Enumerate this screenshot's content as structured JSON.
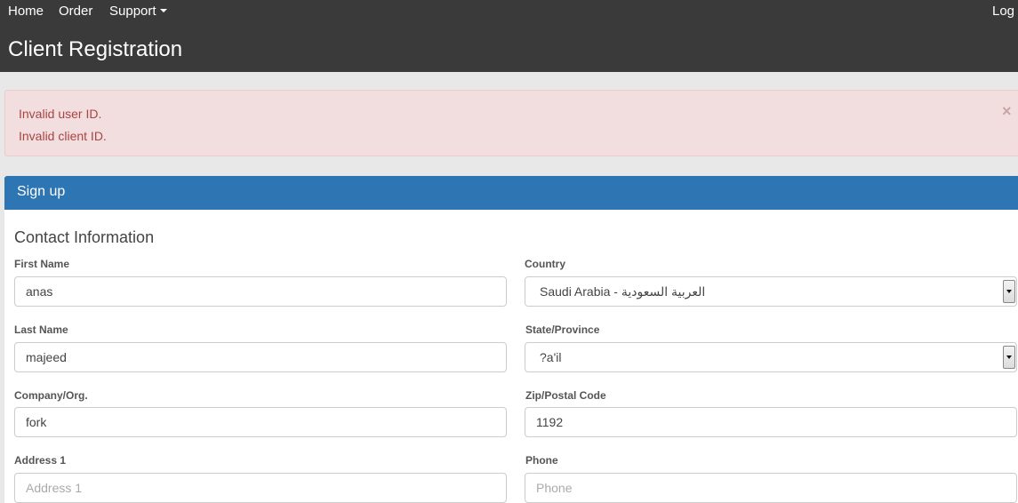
{
  "nav": {
    "home": "Home",
    "order": "Order",
    "support": "Support",
    "login": "Log"
  },
  "header": {
    "title": "Client Registration"
  },
  "alert": {
    "messages": [
      "Invalid user ID.",
      "Invalid client ID."
    ],
    "close": "×"
  },
  "panel": {
    "heading": "Sign up"
  },
  "form": {
    "section_title": "Contact Information",
    "first_name": {
      "label": "First Name",
      "value": "anas"
    },
    "last_name": {
      "label": "Last Name",
      "value": "majeed"
    },
    "company": {
      "label": "Company/Org.",
      "value": "fork"
    },
    "address1": {
      "label": "Address 1",
      "placeholder": "Address 1"
    },
    "country": {
      "label": "Country",
      "value": "Saudi Arabia - العربية السعودية"
    },
    "state": {
      "label": "State/Province",
      "value": "?a'il"
    },
    "zip": {
      "label": "Zip/Postal Code",
      "value": "1192"
    },
    "phone": {
      "label": "Phone",
      "placeholder": "Phone"
    }
  },
  "colors": {
    "topbar": "#3a3a3a",
    "alert_bg": "#f2dede",
    "alert_text": "#a94442",
    "panel_heading": "#2d76b3"
  }
}
